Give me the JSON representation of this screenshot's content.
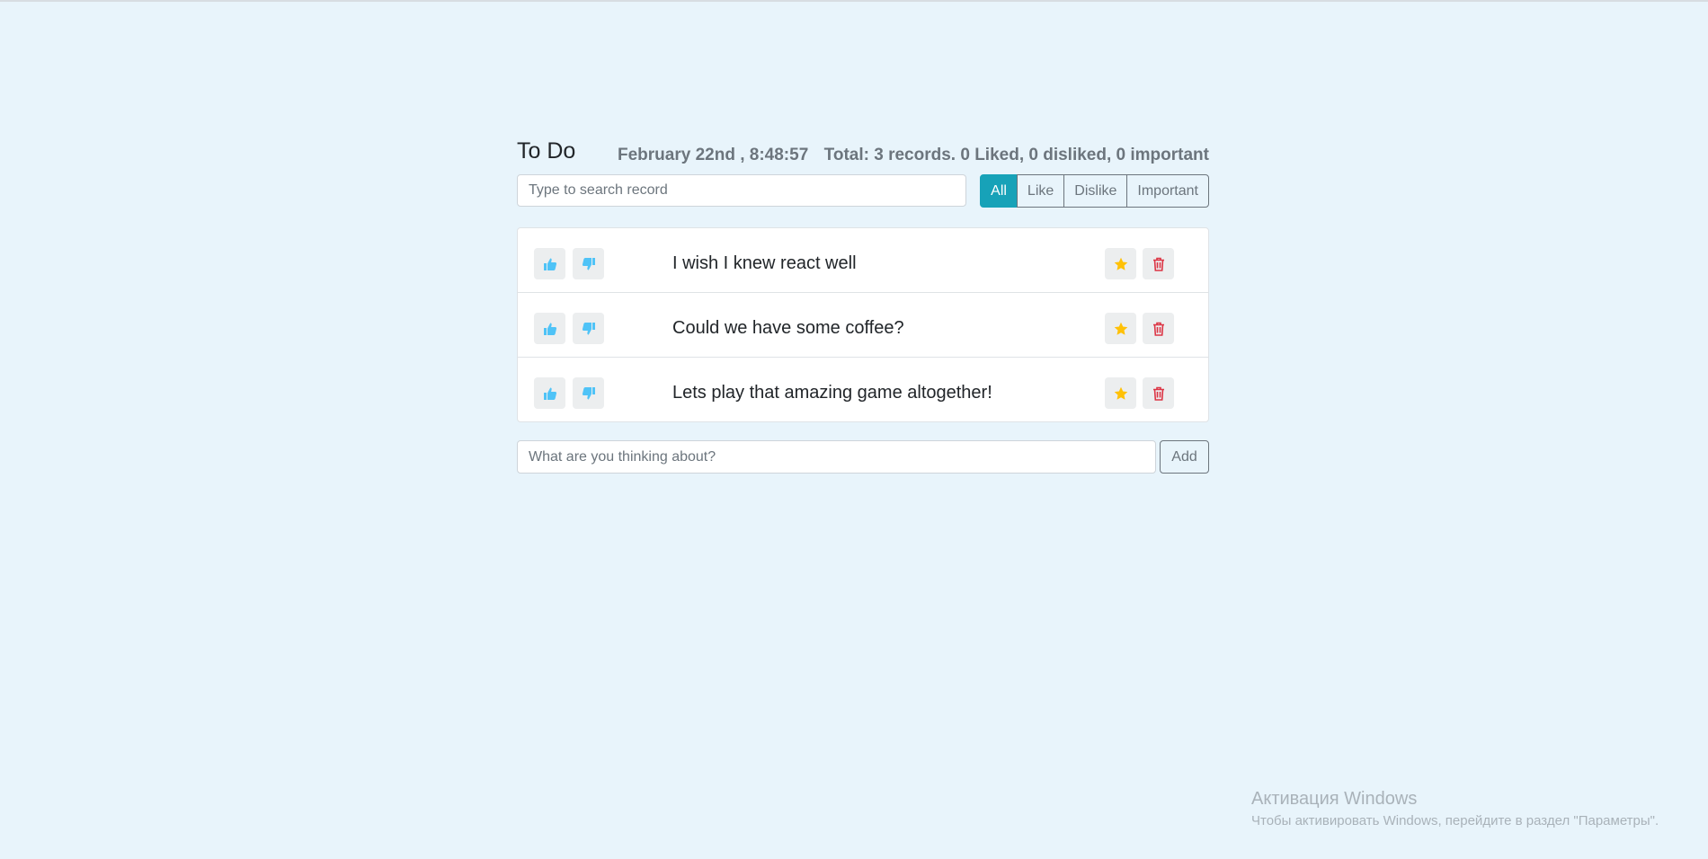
{
  "header": {
    "title": "To Do",
    "date": "February 22nd , 8:48:57",
    "stats": "Total: 3 records. 0 Liked, 0 disliked, 0 important"
  },
  "search": {
    "placeholder": "Type to search record",
    "value": ""
  },
  "filters": [
    {
      "label": "All",
      "active": true
    },
    {
      "label": "Like",
      "active": false
    },
    {
      "label": "Dislike",
      "active": false
    },
    {
      "label": "Important",
      "active": false
    }
  ],
  "items": [
    {
      "label": "I wish I knew react well"
    },
    {
      "label": "Could we have some coffee?"
    },
    {
      "label": "Lets play that amazing game altogether!"
    }
  ],
  "icons": {
    "like": "thumbs-up-icon",
    "dislike": "thumbs-down-icon",
    "important": "star-icon",
    "delete": "trash-icon"
  },
  "colors": {
    "background": "#e8f4fb",
    "accent": "#17a2b8",
    "thumb": "#4fc3f7",
    "star": "#ffc107",
    "trash": "#dc3545"
  },
  "add_form": {
    "placeholder": "What are you thinking about?",
    "button_label": "Add"
  },
  "watermark": {
    "title": "Активация Windows",
    "subtitle": "Чтобы активировать Windows, перейдите в раздел \"Параметры\"."
  }
}
